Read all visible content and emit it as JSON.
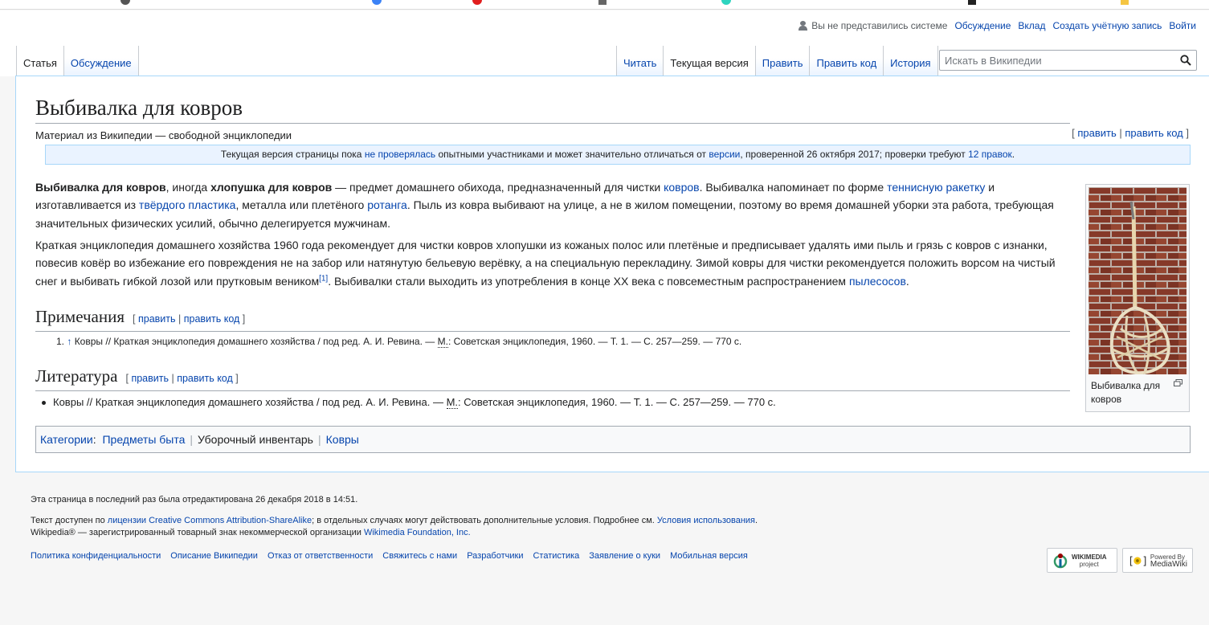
{
  "colors": {
    "link": "#0645ad",
    "text": "#202122",
    "muted": "#54595d",
    "notice_bg": "#eaf3ff",
    "border_blue": "#a7d7f9"
  },
  "personal": {
    "not_logged_in": "Вы не представились системе",
    "talk": "Обсуждение",
    "contributions": "Вклад",
    "create_account": "Создать учётную запись",
    "login": "Войти"
  },
  "tabs_left": [
    "Статья",
    "Обсуждение"
  ],
  "tabs_right": [
    "Читать",
    "Текущая версия",
    "Править",
    "Править код",
    "История"
  ],
  "search": {
    "placeholder": "Искать в Википедии"
  },
  "page": {
    "title": "Выбивалка для ковров",
    "tagline": "Материал из Википедии — свободной энциклопедии",
    "edit": "править",
    "edit_code": "править код",
    "notice": {
      "t1": "Текущая версия страницы пока ",
      "l1": "не проверялась",
      "t2": " опытными участниками и может значительно отличаться от ",
      "l2": "версии",
      "t3": ", проверенной 26 октября 2017; проверки требуют ",
      "l3": "12 правок",
      "t4": "."
    },
    "p1": {
      "b1": "Выбивалка для ковров",
      "t1": ", иногда ",
      "b2": "хлопушка для ковров",
      "t2": " — предмет домашнего обихода, предназначенный для чистки ",
      "l1": "ковров",
      "t3": ". Выбивалка напоминает по форме ",
      "l2": "теннисную ракетку",
      "t4": " и изготавливается из ",
      "l3": "твёрдого пластика",
      "t5": ", металла или плетёного ",
      "l4": "ротанга",
      "t6": ". Пыль из ковра выбивают на улице, а не в жилом помещении, поэтому во время домашней уборки эта работа, требующая значительных физических усилий, обычно делегируется мужчинам."
    },
    "p2": {
      "t1": "Краткая энциклопедия домашнего хозяйства 1960 года рекомендует для чистки ковров хлопушки из кожаных полос или плетёные и предписывает удалять ими пыль и грязь с ковров с изнанки, повесив ковёр во избежание его повреждения не на забор или натянутую бельевую верёвку, а на специальную перекладину. Зимой ковры для чистки рекомендуется положить ворсом на чистый снег и выбивать гибкой лозой или прутковым веником",
      "ref": "[1]",
      "t2": ". Выбивалки стали выходить из употребления в конце XX века с повсеместным распространением ",
      "l1": "пылесосов",
      "t3": "."
    },
    "notes_heading": "Примечания",
    "note1": {
      "num": "1.",
      "arrow": "↑",
      "t1": " Ковры // Краткая энциклопедия домашнего хозяйства / под ред. А. И. Ревина. — ",
      "city": "М.",
      "t2": ": Советская энциклопедия, 1960. — Т. 1. — С. 257—259. — 770 с."
    },
    "lit_heading": "Литература",
    "lit1": {
      "t1": "Ковры // Краткая энциклопедия домашнего хозяйства / под ред. А. И. Ревина. — ",
      "city": "М.",
      "t2": ": Советская энциклопедия, 1960. — Т. 1. — С. 257—259. — 770 с."
    },
    "categories": {
      "label": "Категории",
      "items": [
        "Предметы быта",
        "Уборочный инвентарь",
        "Ковры"
      ]
    },
    "thumb_caption": "Выбивалка для ковров"
  },
  "footer": {
    "last_edited": "Эта страница в последний раз была отредактирована 26 декабря 2018 в 14:51.",
    "license": {
      "t1": "Текст доступен по ",
      "l1": "лицензии Creative Commons Attribution-ShareAlike",
      "t2": "; в отдельных случаях могут действовать дополнительные условия. Подробнее см. ",
      "l2": "Условия использования",
      "t3": "."
    },
    "trademark": {
      "t1": "Wikipedia® — зарегистрированный товарный знак некоммерческой организации ",
      "l1": "Wikimedia Foundation, Inc.",
      "t2": ""
    },
    "links": [
      "Политика конфиденциальности",
      "Описание Википедии",
      "Отказ от ответственности",
      "Свяжитесь с нами",
      "Разработчики",
      "Статистика",
      "Заявление о куки",
      "Мобильная версия"
    ],
    "wmf_badge": {
      "line1": "WIKIMEDIA",
      "line2": "project"
    },
    "mw_badge": {
      "line1": "Powered By",
      "line2": "MediaWiki"
    }
  }
}
